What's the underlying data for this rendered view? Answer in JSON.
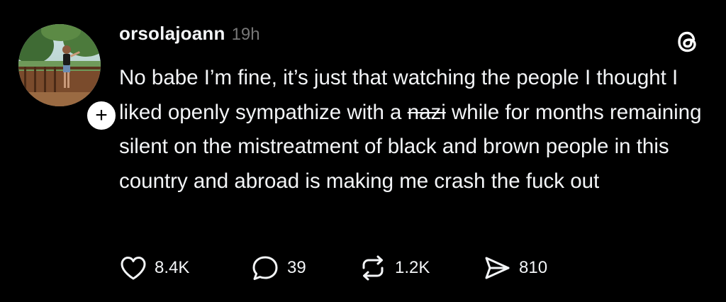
{
  "post": {
    "username": "orsolajoann",
    "timestamp": "19h",
    "follow_badge": "+",
    "text_segments": {
      "before_strike": "No babe I’m fine, it’s just that watching the people I thought I liked openly sympathize with a ",
      "struck": "nazi",
      "after_strike": " while for months remaining silent on the mistreatment of black and brown people in this country and abroad is making me crash the fuck out"
    },
    "actions": {
      "like": {
        "icon": "heart-icon",
        "count": "8.4K"
      },
      "reply": {
        "icon": "speech-bubble-icon",
        "count": "39"
      },
      "repost": {
        "icon": "repost-arrows-icon",
        "count": "1.2K"
      },
      "share": {
        "icon": "send-icon",
        "count": "810"
      }
    },
    "brand_icon": "threads-logo-icon"
  },
  "colors": {
    "background": "#000000",
    "text": "#f3f5f7",
    "muted": "#777777"
  }
}
